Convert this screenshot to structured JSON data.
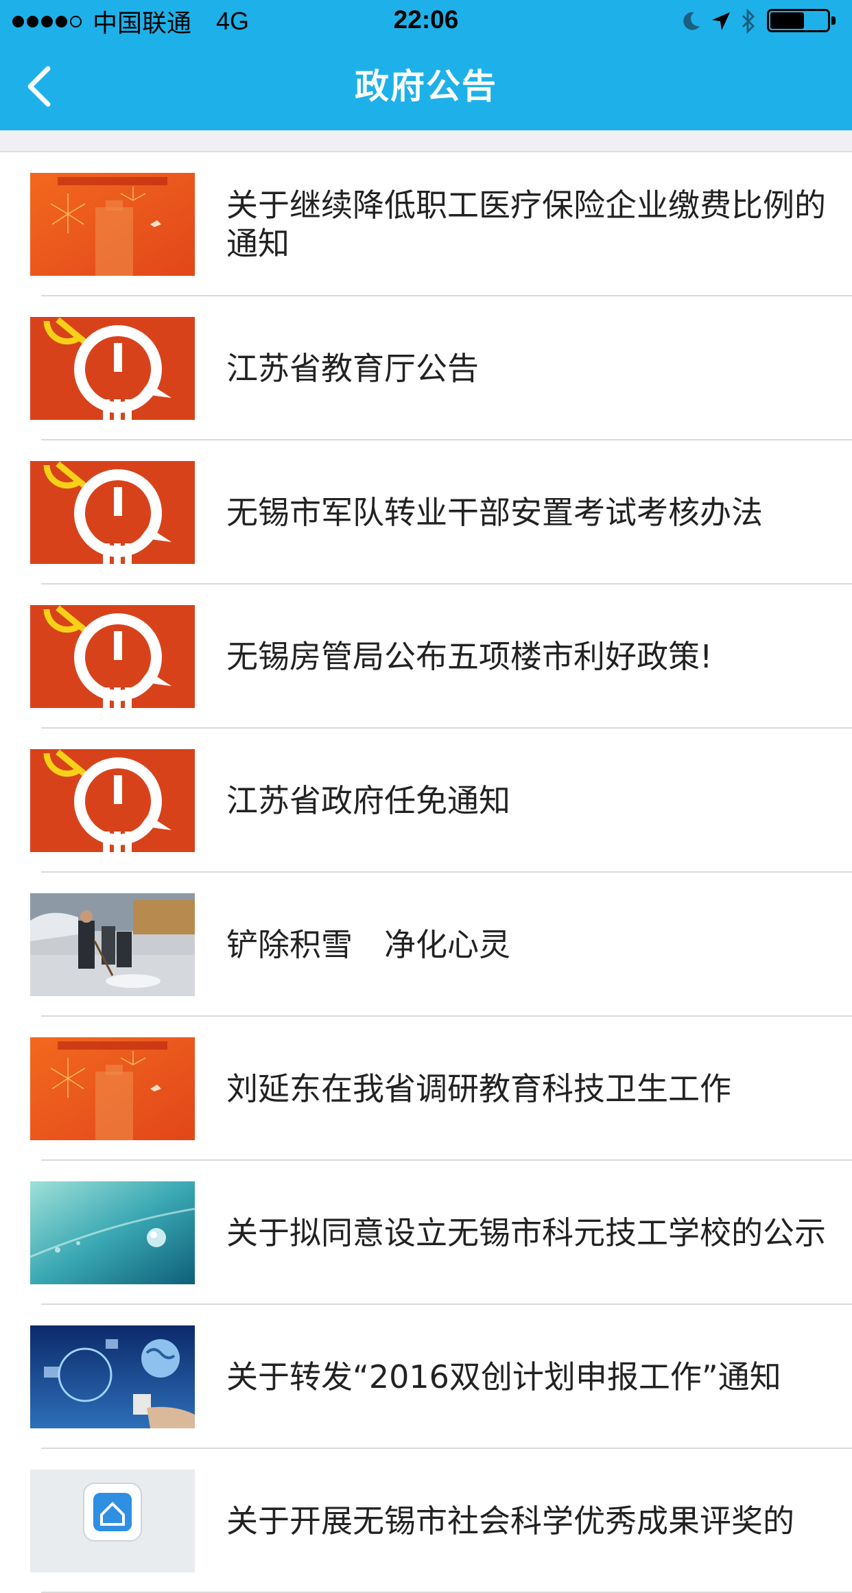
{
  "status_bar": {
    "signal_dots_filled": 4,
    "signal_dots_total": 5,
    "carrier": "中国联通",
    "network": "4G",
    "time": "22:06",
    "icons": [
      "moon-icon",
      "location-arrow-icon",
      "bluetooth-icon",
      "battery-icon"
    ],
    "battery_level": 0.6
  },
  "nav": {
    "back_icon": "chevron-left-icon",
    "title": "政府公告"
  },
  "colors": {
    "nav_background": "#1EB1E9",
    "separator": "#DADADA"
  },
  "articles": [
    {
      "title": "关于继续降低职工医疗保险企业缴费比例的通知",
      "thumbnail": "fireworks-building-image"
    },
    {
      "title": "江苏省教育厅公告",
      "thumbnail": "party-emblem-image"
    },
    {
      "title": "无锡市军队转业干部安置考试考核办法",
      "thumbnail": "party-emblem-image"
    },
    {
      "title": "无锡房管局公布五项楼市利好政策!",
      "thumbnail": "party-emblem-image"
    },
    {
      "title": "江苏省政府任免通知",
      "thumbnail": "party-emblem-image"
    },
    {
      "title": "铲除积雪　净化心灵",
      "thumbnail": "snow-shoveling-photo"
    },
    {
      "title": "刘延东在我省调研教育科技卫生工作",
      "thumbnail": "fireworks-building-image"
    },
    {
      "title": "关于拟同意设立无锡市科元技工学校的公示",
      "thumbnail": "water-drop-image"
    },
    {
      "title": "关于转发“2016双创计划申报工作”通知",
      "thumbnail": "globe-technology-image"
    },
    {
      "title": "关于开展无锡市社会科学优秀成果评奖的",
      "thumbnail": "app-icon-image"
    }
  ]
}
